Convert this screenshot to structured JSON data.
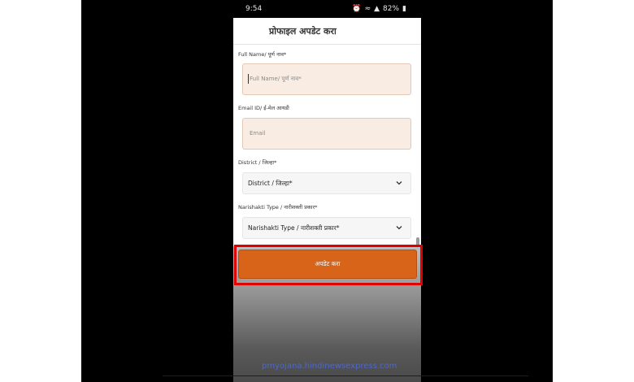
{
  "statusbar": {
    "time": "9:54",
    "battery": "82%",
    "icons": [
      "alarm-icon",
      "wifi-icon",
      "signal-icon",
      "battery-icon"
    ]
  },
  "header": {
    "title": "प्रोफाइल अपडेट करा"
  },
  "form": {
    "full_name": {
      "label": "Full Name/ पूर्ण नाव*",
      "placeholder": "Full Name/ पूर्ण नाव*"
    },
    "email": {
      "label": "Email ID/ ई-मेल आयडी",
      "placeholder": "Email"
    },
    "district": {
      "label": "District / जिल्हा*",
      "value": "District / जिल्हा*"
    },
    "narishakti_type": {
      "label": "Narishakti Type / नारीशक्ती प्रकार*",
      "value": "Narishakti Type / नारीशक्ती प्रकार*"
    },
    "update_button": "अपडेट करा"
  },
  "watermark": "pmyojana.hindinewsexpress.com",
  "colors": {
    "accent": "#d76418",
    "highlight": "#e00000",
    "field_bg": "#f9ece3"
  }
}
